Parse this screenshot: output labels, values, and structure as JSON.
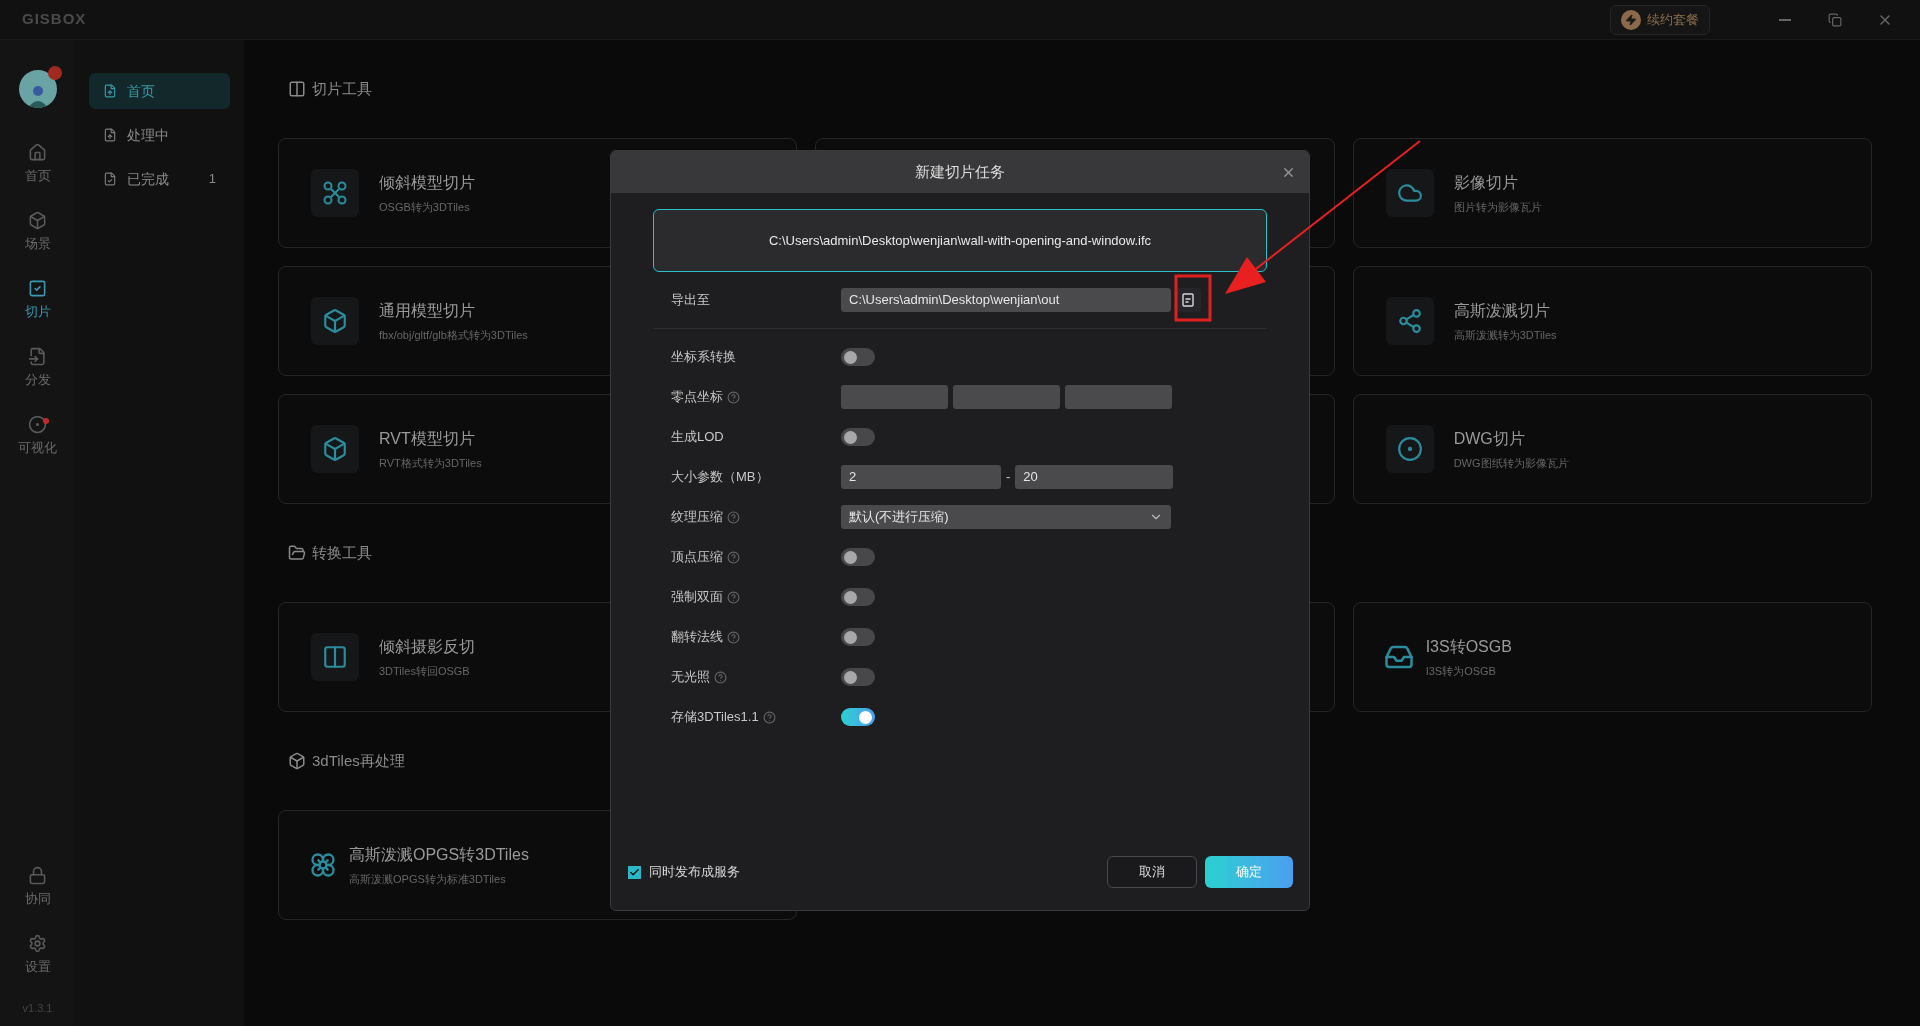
{
  "app": {
    "logo": "GISBOX"
  },
  "top_bar": {
    "renew_button": "续约套餐"
  },
  "nav_rail": {
    "items": [
      {
        "label": "首页",
        "selected": false,
        "dot": false
      },
      {
        "label": "场景",
        "selected": false,
        "dot": false
      },
      {
        "label": "切片",
        "selected": true,
        "dot": false
      },
      {
        "label": "分发",
        "selected": false,
        "dot": false
      },
      {
        "label": "可视化",
        "selected": false,
        "dot": true
      }
    ],
    "bottom_items": [
      {
        "label": "协同"
      },
      {
        "label": "设置"
      }
    ],
    "version": "v1.3.1"
  },
  "sub_sidebar": {
    "items": [
      {
        "label": "首页",
        "selected": true
      },
      {
        "label": "处理中",
        "selected": false
      },
      {
        "label": "已完成",
        "selected": false,
        "count": "1"
      }
    ]
  },
  "sections": [
    {
      "title": "切片工具",
      "cards": [
        {
          "kind": "tool",
          "title": "倾斜模型切片",
          "subtitle": "OSGB转为3DTiles"
        },
        {
          "kind": "covered"
        },
        {
          "kind": "tool",
          "title": "影像切片",
          "subtitle": "图片转为影像瓦片"
        },
        {
          "kind": "tool",
          "title": "通用模型切片",
          "subtitle": "fbx/obj/gltf/glb格式转为3DTiles"
        },
        {
          "kind": "covered"
        },
        {
          "kind": "tool",
          "title": "高斯泼溅切片",
          "subtitle": "高斯泼溅转为3DTiles"
        },
        {
          "kind": "tool",
          "title": "RVT模型切片",
          "subtitle": "RVT格式转为3DTiles"
        },
        {
          "kind": "covered"
        },
        {
          "kind": "tool",
          "title": "DWG切片",
          "subtitle": "DWG图纸转为影像瓦片"
        }
      ]
    },
    {
      "title": "转换工具",
      "cards": [
        {
          "kind": "tool",
          "title": "倾斜摄影反切",
          "subtitle": "3DTiles转回OSGB"
        },
        {
          "kind": "covered"
        },
        {
          "kind": "compact",
          "title": "I3S转OSGB",
          "subtitle": "I3S转为OSGB"
        }
      ]
    },
    {
      "title": "3dTiles再处理",
      "cards": [
        {
          "kind": "compact",
          "title": "高斯泼溅OPGS转3DTiles",
          "subtitle": "高斯泼溅OPGS转为标准3DTiles"
        }
      ]
    }
  ],
  "dialog": {
    "title": "新建切片任务",
    "source_file": "C:\\Users\\admin\\Desktop\\wenjian\\wall-with-opening-and-window.ifc",
    "fields": [
      {
        "kind": "path",
        "label": "导出至",
        "help": false,
        "value": "C:\\Users\\admin\\Desktop\\wenjian\\out"
      },
      {
        "kind": "toggle",
        "label": "坐标系转换",
        "help": false,
        "on": false
      },
      {
        "kind": "triple",
        "label": "零点坐标",
        "help": true
      },
      {
        "kind": "toggle",
        "label": "生成LOD",
        "help": false,
        "on": false
      },
      {
        "kind": "range",
        "label": "大小参数（MB）",
        "help": false,
        "min": "2",
        "separator": "-",
        "max": "20"
      },
      {
        "kind": "select",
        "label": "纹理压缩",
        "help": true,
        "value": "默认(不进行压缩)"
      },
      {
        "kind": "toggle",
        "label": "顶点压缩",
        "help": true,
        "on": false
      },
      {
        "kind": "toggle",
        "label": "强制双面",
        "help": true,
        "on": false
      },
      {
        "kind": "toggle",
        "label": "翻转法线",
        "help": true,
        "on": false
      },
      {
        "kind": "toggle",
        "label": "无光照",
        "help": true,
        "on": false
      },
      {
        "kind": "toggle",
        "label": "存储3DTiles1.1",
        "help": true,
        "on": true
      }
    ],
    "publish": {
      "label": "同时发布成服务",
      "checked": true
    },
    "buttons": [
      {
        "kind": "secondary",
        "label": "取消"
      },
      {
        "kind": "primary",
        "label": "确定"
      }
    ]
  }
}
